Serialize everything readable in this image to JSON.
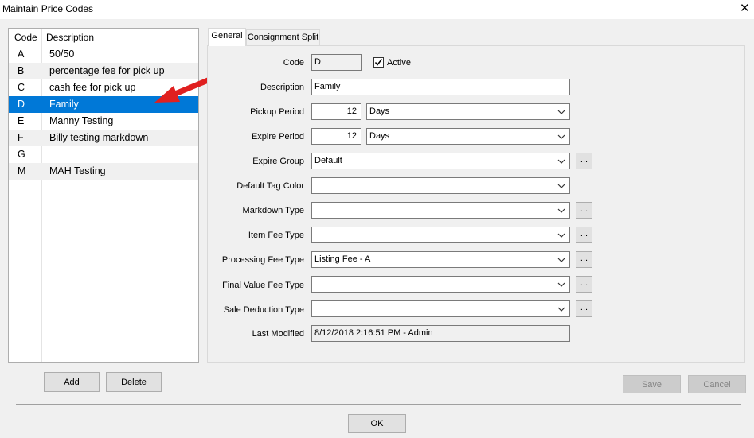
{
  "window": {
    "title": "Maintain Price Codes",
    "close_glyph": "✕"
  },
  "list": {
    "headers": {
      "code": "Code",
      "description": "Description"
    },
    "rows": [
      {
        "code": "A",
        "description": "50/50"
      },
      {
        "code": "B",
        "description": "percentage fee for pick up"
      },
      {
        "code": "C",
        "description": "cash fee for pick up"
      },
      {
        "code": "D",
        "description": "Family",
        "selected": true
      },
      {
        "code": "E",
        "description": "Manny Testing"
      },
      {
        "code": "F",
        "description": "Billy testing markdown"
      },
      {
        "code": "G",
        "description": ""
      },
      {
        "code": "M",
        "description": "MAH Testing"
      }
    ]
  },
  "buttons": {
    "add": "Add",
    "delete": "Delete",
    "save": "Save",
    "cancel": "Cancel",
    "ok": "OK",
    "ellipsis": "..."
  },
  "tabs": [
    {
      "label": "General",
      "active": true
    },
    {
      "label": "Consignment Split",
      "active": false
    }
  ],
  "form": {
    "code": {
      "label": "Code",
      "value": "D"
    },
    "active": {
      "label": "Active",
      "checked": true
    },
    "description": {
      "label": "Description",
      "value": "Family"
    },
    "pickup_period": {
      "label": "Pickup Period",
      "value": "12",
      "unit": "Days"
    },
    "expire_period": {
      "label": "Expire Period",
      "value": "12",
      "unit": "Days"
    },
    "expire_group": {
      "label": "Expire Group",
      "value": "Default"
    },
    "default_tag_color": {
      "label": "Default Tag Color",
      "value": ""
    },
    "markdown_type": {
      "label": "Markdown Type",
      "value": ""
    },
    "item_fee_type": {
      "label": "Item Fee Type",
      "value": ""
    },
    "processing_fee_type": {
      "label": "Processing Fee Type",
      "value": "Listing Fee - A"
    },
    "final_value_fee_type": {
      "label": "Final Value Fee Type",
      "value": ""
    },
    "sale_deduction_type": {
      "label": "Sale Deduction Type",
      "value": ""
    },
    "last_modified": {
      "label": "Last Modified",
      "value": "8/12/2018 2:16:51 PM - Admin"
    }
  },
  "colors": {
    "selection": "#0078d7",
    "annotation_arrow": "#e02020"
  }
}
